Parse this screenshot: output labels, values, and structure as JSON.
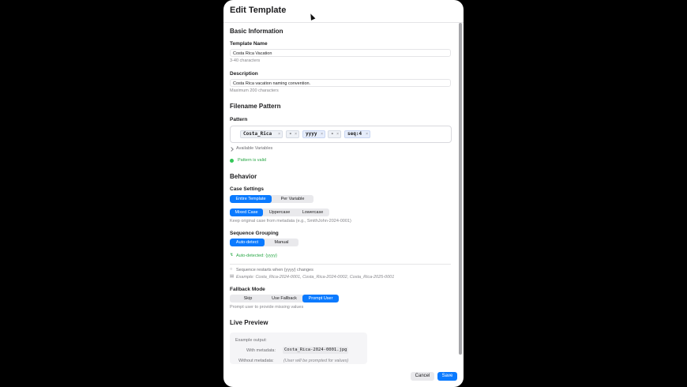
{
  "modal": {
    "title": "Edit Template"
  },
  "basic": {
    "section_title": "Basic Information",
    "name_label": "Template Name",
    "name_value": "Costa Rica Vacation",
    "name_hint": "3-40 characters",
    "desc_label": "Description",
    "desc_value": "Costa Rica vacation naming convention.",
    "desc_hint": "Maximum 200 characters"
  },
  "pattern": {
    "section_title": "Filename Pattern",
    "label": "Pattern",
    "tokens": [
      "Costa_Rica",
      "-",
      "yyyy",
      "-",
      "seq:4"
    ],
    "remove_glyph": "×",
    "available_variables": "Available Variables",
    "valid_text": "Pattern is valid"
  },
  "behavior": {
    "section_title": "Behavior",
    "case_label": "Case Settings",
    "scope_options": [
      "Entire Template",
      "Per Variable"
    ],
    "case_options": [
      "Mixed Case",
      "Uppercase",
      "Lowercase"
    ],
    "case_hint": "Keep original case from metadata (e.g., SmithJohn-2024-0001)",
    "sequence_label": "Sequence Grouping",
    "sequence_options": [
      "Auto-detect",
      "Manual"
    ],
    "auto_detected": "Auto-detected: {yyyy}",
    "restart_note": "Sequence restarts when {yyyy} changes",
    "example_note": "Example: Costa_Rica-2024-0001, Costa_Rica-2024-0002, Costa_Rica-2025-0001",
    "fallback_label": "Fallback Mode",
    "fallback_options": [
      "Skip",
      "Use Fallback",
      "Prompt User"
    ],
    "fallback_hint": "Prompt user to provide missing values"
  },
  "preview": {
    "section_title": "Live Preview",
    "example_label": "Example output:",
    "with_label": "With metadata:",
    "with_value": "Costa_Rica-2024-0001.jpg",
    "without_label": "Without metadata:",
    "without_value": "(User will be prompted for values)"
  },
  "footer": {
    "cancel": "Cancel",
    "save": "Save"
  },
  "colors": {
    "accent": "#0a7aff",
    "success": "#28a745"
  }
}
